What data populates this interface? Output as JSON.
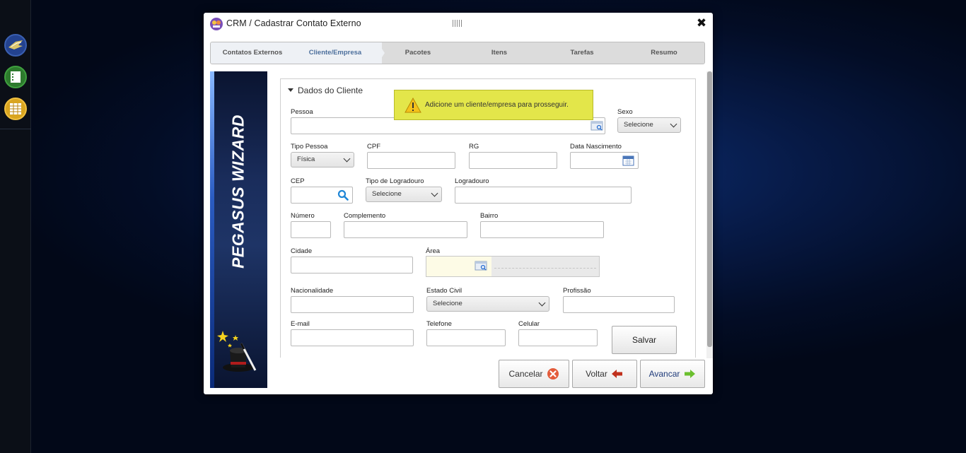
{
  "sidebar": {
    "icons": [
      "wings-icon",
      "list-icon",
      "table-grid-icon"
    ]
  },
  "dialog": {
    "title": "CRM / Cadastrar Contato Externo",
    "close_label": "✖"
  },
  "steps": [
    {
      "label": "Contatos Externos",
      "state": "done"
    },
    {
      "label": "Cliente/Empresa",
      "state": "active"
    },
    {
      "label": "Pacotes",
      "state": "pending"
    },
    {
      "label": "Itens",
      "state": "pending"
    },
    {
      "label": "Tarefas",
      "state": "pending"
    },
    {
      "label": "Resumo",
      "state": "pending"
    }
  ],
  "banner": {
    "title": "PEGASUS WIZARD"
  },
  "form": {
    "section_title": "Dados do Cliente",
    "pessoa_label": "Pessoa",
    "sexo_label": "Sexo",
    "sexo_value": "Selecione",
    "tipo_pessoa_label": "Tipo Pessoa",
    "tipo_pessoa_value": "Física",
    "cpf_label": "CPF",
    "rg_label": "RG",
    "data_nascimento_label": "Data Nascimento",
    "cep_label": "CEP",
    "tipo_logradouro_label": "Tipo de Logradouro",
    "tipo_logradouro_value": "Selecione",
    "logradouro_label": "Logradouro",
    "numero_label": "Número",
    "complemento_label": "Complemento",
    "bairro_label": "Bairro",
    "cidade_label": "Cidade",
    "area_label": "Área",
    "nacionalidade_label": "Nacionalidade",
    "estado_civil_label": "Estado Civil",
    "estado_civil_value": "Selecione",
    "profissao_label": "Profissão",
    "email_label": "E-mail",
    "telefone_label": "Telefone",
    "celular_label": "Celular",
    "save_label": "Salvar"
  },
  "toast": {
    "message": "Adicione um cliente/empresa para prosseguir."
  },
  "footer": {
    "cancel_label": "Cancelar",
    "back_label": "Voltar",
    "next_label": "Avancar"
  },
  "colors": {
    "active_step": "#4c6f9c",
    "toast_bg": "#e3e64a",
    "cancel_icon": "#e35b3a",
    "back_icon": "#c0301c",
    "next_icon": "#6bbf2e",
    "next_text": "#1f3b7a"
  }
}
